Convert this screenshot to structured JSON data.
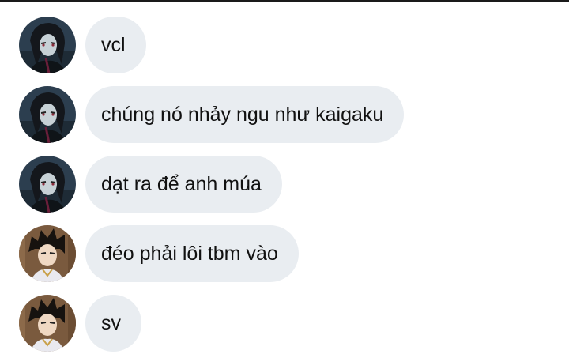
{
  "messages": [
    {
      "avatar": "dark-haired-character-avatar",
      "text": "vcl"
    },
    {
      "avatar": "dark-haired-character-avatar",
      "text": "chúng nó nhảy ngu như kaigaku"
    },
    {
      "avatar": "dark-haired-character-avatar",
      "text": "dạt ra để anh múa"
    },
    {
      "avatar": "spiky-haired-character-avatar",
      "text": "đéo phải lôi tbm vào"
    },
    {
      "avatar": "spiky-haired-character-avatar",
      "text": "sv"
    }
  ],
  "colors": {
    "bubble": "#e9edf1",
    "text": "#111111",
    "background": "#ffffff"
  }
}
